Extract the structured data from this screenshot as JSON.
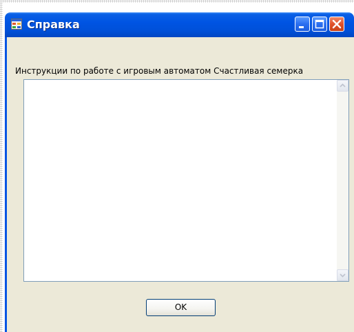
{
  "window": {
    "title": "Справка",
    "icon": "form-icon"
  },
  "caption_buttons": {
    "minimize_icon": "minimize-icon",
    "maximize_icon": "maximize-icon",
    "close_icon": "close-icon"
  },
  "content": {
    "instructions_label": "Инструкции по работе с игровым автоматом Счастливая семерка",
    "text_area_value": ""
  },
  "buttons": {
    "ok_label": "OK"
  },
  "colors": {
    "titlebar": "#0054e3",
    "client_background": "#ece9d8",
    "textbox_border": "#7f9db9"
  }
}
